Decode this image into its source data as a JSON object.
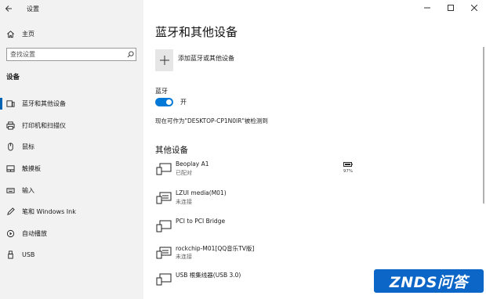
{
  "window": {
    "title": "设置"
  },
  "sidebar": {
    "home_label": "主页",
    "search_placeholder": "查找设置",
    "section_heading": "设备",
    "items": [
      {
        "label": "蓝牙和其他设备",
        "icon": "bluetooth-devices-icon",
        "active": true
      },
      {
        "label": "打印机和扫描仪",
        "icon": "printer-icon",
        "active": false
      },
      {
        "label": "鼠标",
        "icon": "mouse-icon",
        "active": false
      },
      {
        "label": "触摸板",
        "icon": "touchpad-icon",
        "active": false
      },
      {
        "label": "输入",
        "icon": "keyboard-icon",
        "active": false
      },
      {
        "label": "笔和 Windows Ink",
        "icon": "pen-icon",
        "active": false
      },
      {
        "label": "自动播放",
        "icon": "autoplay-icon",
        "active": false
      },
      {
        "label": "USB",
        "icon": "usb-icon",
        "active": false
      }
    ]
  },
  "main": {
    "page_title": "蓝牙和其他设备",
    "add_device_label": "添加蓝牙或其他设备",
    "bluetooth_label": "蓝牙",
    "bluetooth_toggle": {
      "on": true,
      "state_label": "开"
    },
    "discoverable_text": "现在可作为\"DESKTOP-CP1N0IR\"被检测到",
    "other_devices_heading": "其他设备",
    "devices": [
      {
        "name": "Beoplay A1",
        "status": "已配对",
        "icon": "audio-device-icon",
        "battery": "97%"
      },
      {
        "name": "LZUI media(M01)",
        "status": "未连接",
        "icon": "media-device-icon"
      },
      {
        "name": "PCI to PCI Bridge",
        "status": "",
        "icon": "generic-device-icon"
      },
      {
        "name": "rockchip-M01[QQ音乐TV版]",
        "status": "未连接",
        "icon": "media-device-icon"
      },
      {
        "name": "USB 根集线器(USB 3.0)",
        "status": "",
        "icon": "generic-device-icon"
      }
    ]
  },
  "watermark": {
    "text": "ZNDS问答"
  },
  "colors": {
    "accent": "#0078d7",
    "watermark_bg": "#0b66c7"
  }
}
